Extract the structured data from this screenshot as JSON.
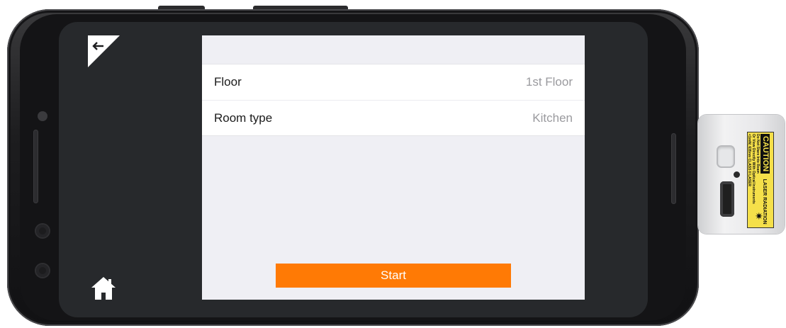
{
  "app": {
    "nav": {
      "back_icon": "back-arrow-icon",
      "home_icon": "home-icon"
    },
    "form": {
      "rows": [
        {
          "label": "Floor",
          "value": "1st Floor"
        },
        {
          "label": "Room type",
          "value": "Kitchen"
        }
      ]
    },
    "start_button": {
      "label": "Start"
    }
  },
  "device": {
    "caution": {
      "heading": "CAUTION",
      "title": "LASER RADIATION",
      "line1": "Do Not Stare Into Beam",
      "line2": "Or View Directly With Optical Instruments",
      "line3": "<1mW, 635nm CLASS II LASER"
    }
  },
  "colors": {
    "accent": "#ff7a05",
    "screen_bg": "#27292c",
    "panel_bg": "#efeff4",
    "caution_yellow": "#f5e04a"
  }
}
